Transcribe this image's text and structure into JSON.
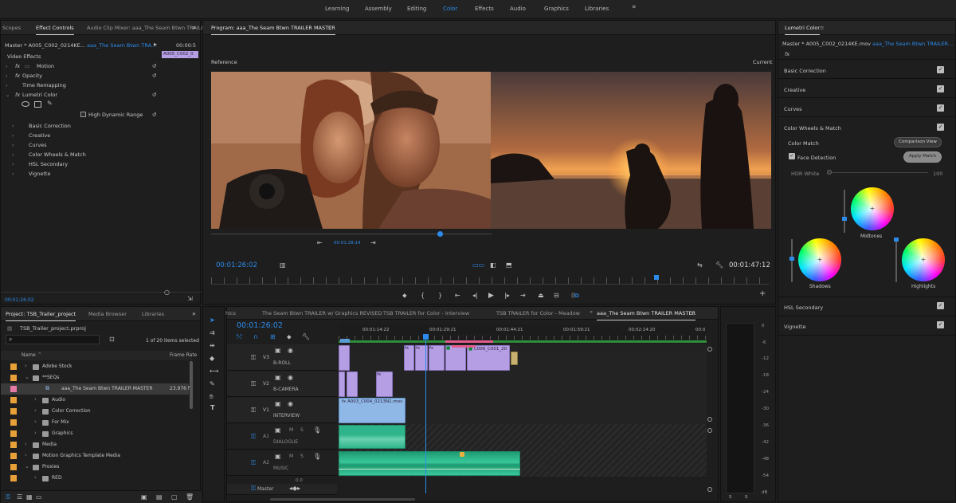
{
  "workspaces": [
    "Learning",
    "Assembly",
    "Editing",
    "Color",
    "Effects",
    "Audio",
    "Graphics",
    "Libraries"
  ],
  "workspaces_more": "»",
  "effect_controls": {
    "tabs": [
      "Scopes",
      "Effect Controls",
      "Audio Clip Mixer: aaa_The Seam  Btwn TRAILER MASTER"
    ],
    "master": "Master * A005_C002_0214KE...",
    "sequence": "aaa_The Seam  Btwn TRA...",
    "time_small": "00:00:5",
    "clip_label": "A005_C002_0",
    "section": "Video Effects",
    "effects": [
      "Motion",
      "Opacity",
      "Time Remapping",
      "Lumetri Color"
    ],
    "hdr_label": "High Dynamic Range",
    "subsections": [
      "Basic Correction",
      "Creative",
      "Curves",
      "Color Wheels & Match",
      "HSL Secondary",
      "Vignette"
    ],
    "timecode": "00:01:26:02"
  },
  "program": {
    "title": "Program: aaa_The Seam  Btwn TRAILER MASTER",
    "reference": "Reference",
    "current": "Current",
    "ref_timecode": "00:01:28:14",
    "timecode_left": "00:01:26:02",
    "timecode_right": "00:01:47:12"
  },
  "lumetri": {
    "title": "Lumetri Color",
    "master": "Master * A005_C002_0214KE.mov",
    "sequence": "aaa_The Seam  Btwn TRAILER...",
    "fx": "fx",
    "sections": [
      "Basic Correction",
      "Creative",
      "Curves",
      "Color Wheels & Match"
    ],
    "color_match": "Color Match",
    "comparison_view": "Comparison View",
    "face_detection": "Face Detection",
    "apply_match": "Apply Match",
    "hdr_white": "HDR White",
    "hdr_value": "100",
    "wheel_labels": [
      "Midtones",
      "Shadows",
      "Highlights"
    ],
    "bottom_sections": [
      "HSL Secondary",
      "Vignette"
    ]
  },
  "project": {
    "tabs": [
      "Project: TSB_Trailer_project",
      "Media Browser",
      "Libraries"
    ],
    "file": "TSB_Trailer_project.prproj",
    "count": "1 of 20 items selected",
    "col_name": "Name",
    "col_rate": "Frame Rate",
    "items": [
      {
        "name": "Adobe Stock",
        "indent": 0,
        "rate": ""
      },
      {
        "name": "**SEQs",
        "indent": 0,
        "rate": ""
      },
      {
        "name": "aaa_The Seam  Btwn TRAILER MASTER",
        "indent": 2,
        "rate": "23.976 f"
      },
      {
        "name": "Audio",
        "indent": 1,
        "rate": ""
      },
      {
        "name": "Color Correction",
        "indent": 1,
        "rate": ""
      },
      {
        "name": "For Mix",
        "indent": 1,
        "rate": ""
      },
      {
        "name": "Graphics",
        "indent": 1,
        "rate": ""
      },
      {
        "name": "Media",
        "indent": 0,
        "rate": ""
      },
      {
        "name": "Motion Graphics Template Media",
        "indent": 0,
        "rate": ""
      },
      {
        "name": "Proxies",
        "indent": 0,
        "rate": ""
      },
      {
        "name": "RED",
        "indent": 1,
        "rate": ""
      }
    ]
  },
  "timeline": {
    "tabs": [
      "hics",
      "The Seam Btwn TRAILER w/ Graphics REVISED",
      "TSB TRAILER for Color - Interview",
      "TSB TRAILER for Color - Meadow",
      "aaa_The Seam  Btwn TRAILER MASTER"
    ],
    "timecode": "00:01:26:02",
    "ruler": [
      "00:01:14:22",
      "00:01:29:21",
      "00:01:44:21",
      "00:01:59:21",
      "00:02:14:20",
      "00:0"
    ],
    "tracks": [
      {
        "id": "V3",
        "name": "B-ROLL"
      },
      {
        "id": "V2",
        "name": "B-CAMERA"
      },
      {
        "id": "V1",
        "name": "INTERVIEW"
      },
      {
        "id": "A1",
        "name": "DIALOGUE"
      },
      {
        "id": "A2",
        "name": "MUSIC"
      }
    ],
    "master": "Master",
    "master_value": "0.0",
    "clip_v1": "A003_C004_0213N1.mov",
    "clip_v3": "C006_C001_20"
  },
  "meter_scale": [
    "0",
    "-6",
    "-12",
    "-18",
    "-24",
    "-30",
    "-36",
    "-42",
    "-48",
    "-54",
    "dB"
  ],
  "meter_buttons": [
    "S",
    "S"
  ]
}
